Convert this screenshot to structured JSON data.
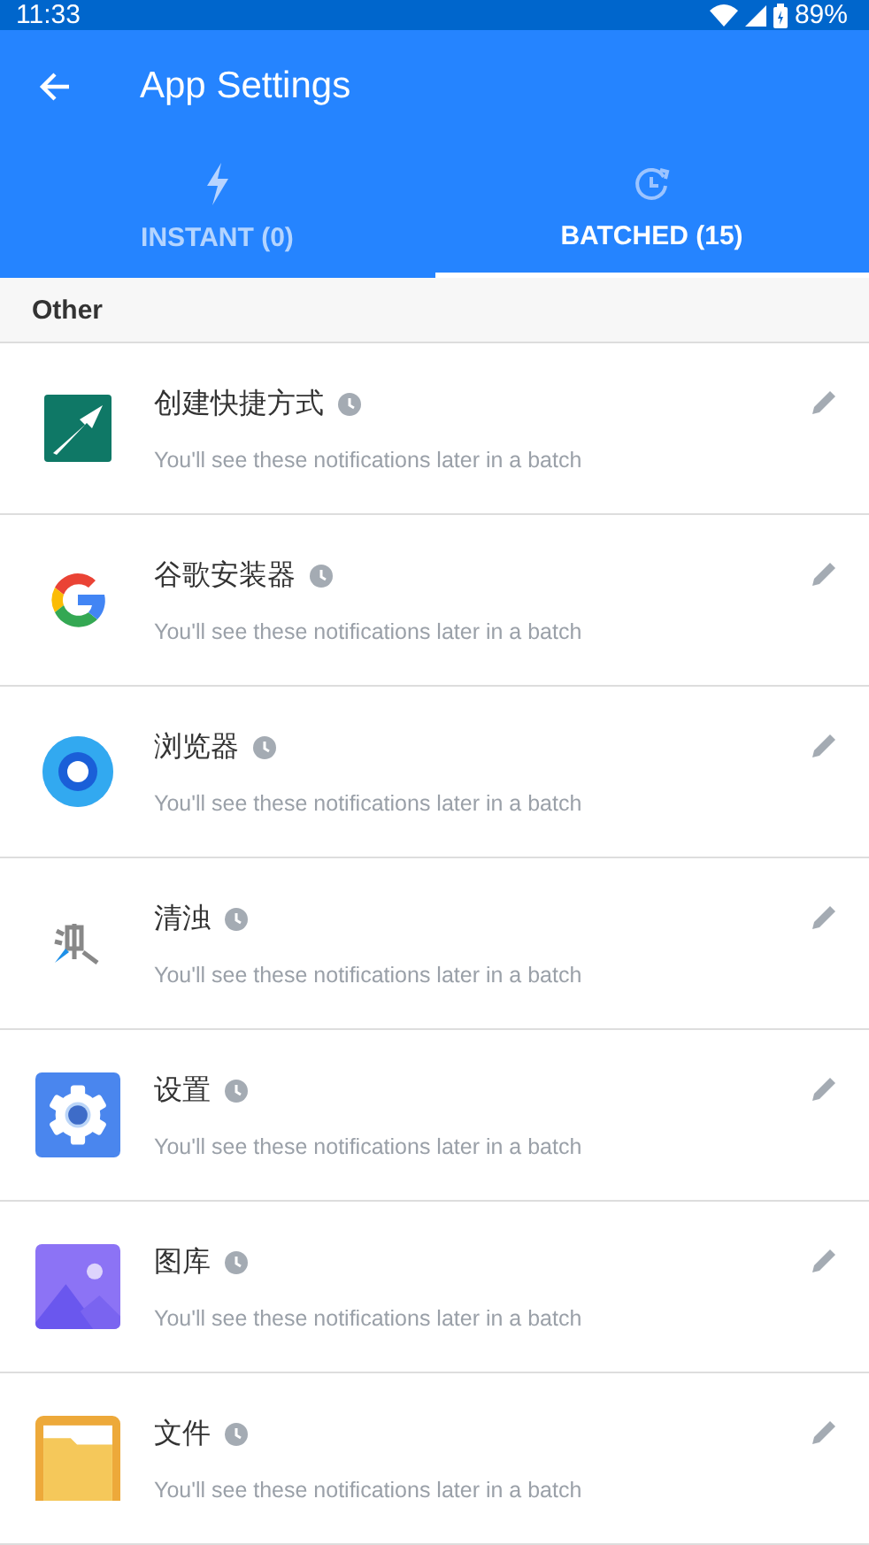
{
  "status_bar": {
    "time": "11:33",
    "battery": "89%"
  },
  "app_bar": {
    "title": "App Settings"
  },
  "tabs": [
    {
      "label": "INSTANT (0)",
      "kind": "instant",
      "selected": false
    },
    {
      "label": "BATCHED (15)",
      "kind": "batched",
      "selected": true
    }
  ],
  "section": {
    "title": "Other"
  },
  "apps": [
    {
      "name": "创建快捷方式",
      "kind": "shortcut",
      "subtitle": "You'll see these notifications later in a batch"
    },
    {
      "name": "谷歌安装器",
      "kind": "google",
      "subtitle": "You'll see these notifications later in a batch"
    },
    {
      "name": "浏览器",
      "kind": "browser",
      "subtitle": "You'll see these notifications later in a batch"
    },
    {
      "name": "清浊",
      "kind": "brush",
      "subtitle": "You'll see these notifications later in a batch"
    },
    {
      "name": "设置",
      "kind": "settings",
      "subtitle": "You'll see these notifications later in a batch"
    },
    {
      "name": "图库",
      "kind": "gallery",
      "subtitle": "You'll see these notifications later in a batch"
    },
    {
      "name": "文件",
      "kind": "files",
      "subtitle": "You'll see these notifications later in a batch"
    }
  ]
}
